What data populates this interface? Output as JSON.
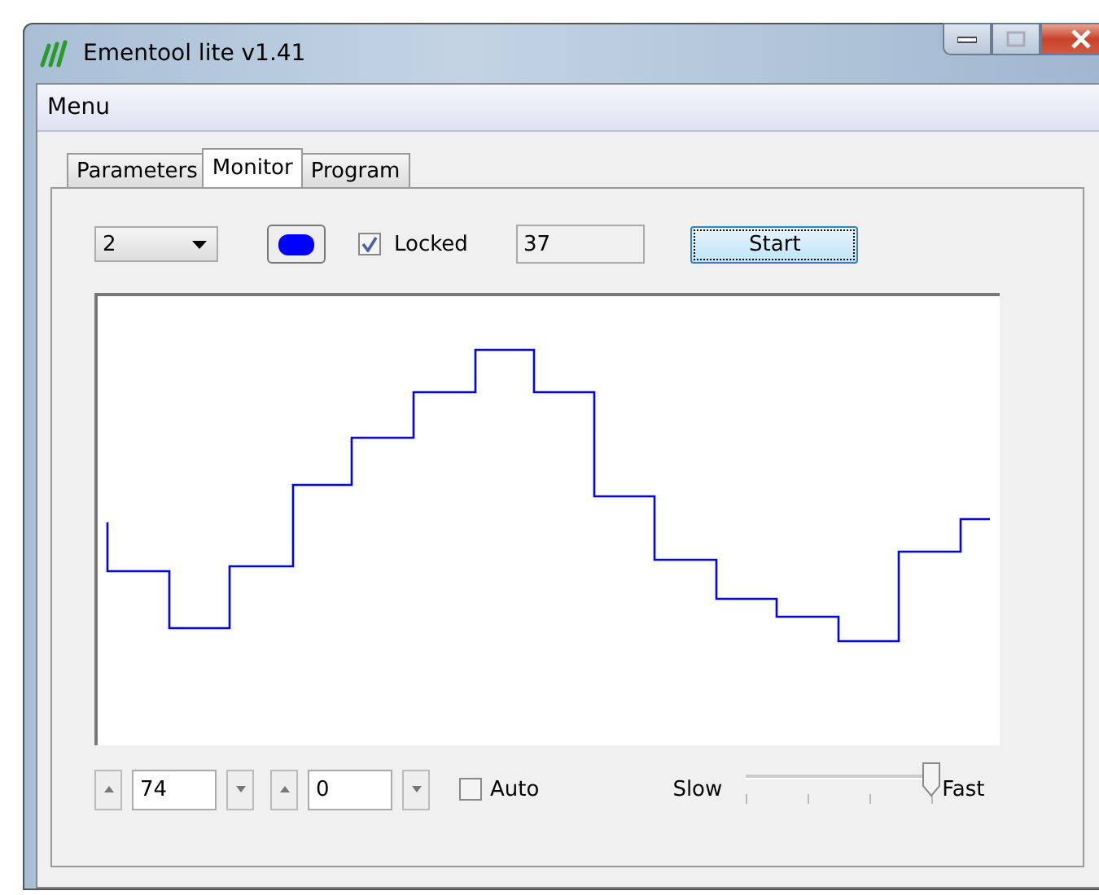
{
  "window": {
    "title": "Ementool lite v1.41"
  },
  "menu": [
    "Menu"
  ],
  "tabs": [
    {
      "label": "Parameters",
      "selected": false
    },
    {
      "label": "Monitor",
      "selected": true
    },
    {
      "label": "Program",
      "selected": false
    }
  ],
  "controls": {
    "channel": "2",
    "color_button": {
      "color": "#0000ff"
    },
    "locked": {
      "label": "Locked",
      "checked": true
    },
    "reading": "37",
    "start_button": "Start"
  },
  "bottom": {
    "spinners": [
      {
        "value": "74"
      },
      {
        "value": "0"
      }
    ],
    "auto": {
      "label": "Auto",
      "checked": false
    },
    "speed": {
      "min_label": "Slow",
      "max_label": "Fast",
      "level": 1
    }
  }
}
